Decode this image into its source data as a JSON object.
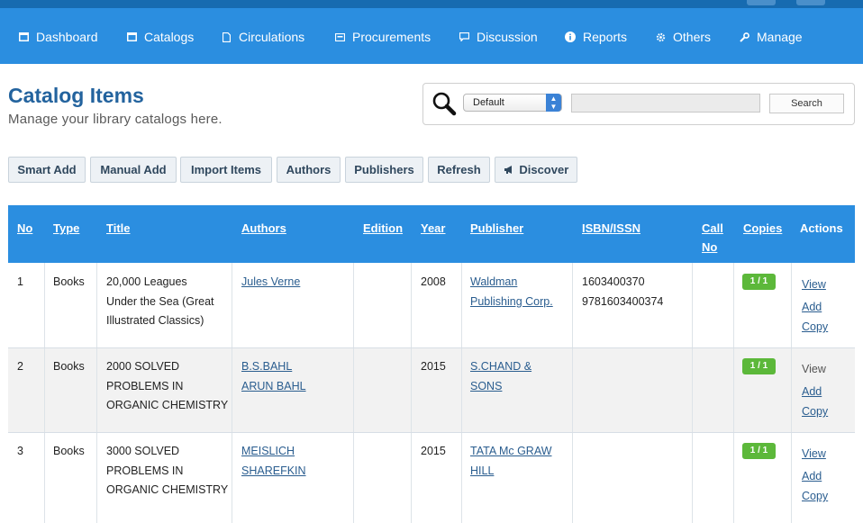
{
  "nav": {
    "items": [
      {
        "label": "Dashboard",
        "icon": "dashboard-icon"
      },
      {
        "label": "Catalogs",
        "icon": "catalogs-icon"
      },
      {
        "label": "Circulations",
        "icon": "circulations-icon"
      },
      {
        "label": "Procurements",
        "icon": "procurements-icon"
      },
      {
        "label": "Discussion",
        "icon": "discussion-icon"
      },
      {
        "label": "Reports",
        "icon": "info-icon"
      },
      {
        "label": "Others",
        "icon": "gear-icon"
      },
      {
        "label": "Manage",
        "icon": "wrench-icon"
      }
    ]
  },
  "page": {
    "title": "Catalog Items",
    "subtitle": "Manage your library catalogs here."
  },
  "search": {
    "select_value": "Default",
    "input_value": "",
    "button_label": "Search"
  },
  "toolbar": {
    "buttons": [
      {
        "label": "Smart Add"
      },
      {
        "label": "Manual Add"
      },
      {
        "label": "Import Items"
      },
      {
        "label": "Authors"
      },
      {
        "label": "Publishers"
      },
      {
        "label": "Refresh"
      },
      {
        "label": "Discover",
        "icon": "megaphone-icon"
      }
    ]
  },
  "table": {
    "headers": {
      "no": "No",
      "type": "Type",
      "title": "Title",
      "authors": "Authors",
      "edition": "Edition",
      "year": "Year",
      "publisher": "Publisher",
      "isbn": "ISBN/ISSN",
      "callno_1": "Call",
      "callno_2": "No",
      "copies": "Copies",
      "actions": "Actions"
    },
    "rows": [
      {
        "no": "1",
        "type": "Books",
        "title": [
          "20,000 Leagues",
          "Under the Sea (Great",
          "Illustrated Classics)"
        ],
        "authors": [
          "Jules Verne"
        ],
        "edition": "",
        "year": "2008",
        "publisher": [
          "Waldman",
          "Publishing Corp."
        ],
        "isbn": [
          "1603400370",
          "9781603400374"
        ],
        "callno": "",
        "copies": "1 / 1",
        "actions": {
          "view": "View",
          "add": "Add",
          "copy": "Copy"
        }
      },
      {
        "no": "2",
        "type": "Books",
        "title": [
          "2000 SOLVED",
          "PROBLEMS IN",
          "ORGANIC CHEMISTRY"
        ],
        "authors": [
          "B.S.BAHL",
          "ARUN BAHL"
        ],
        "edition": "",
        "year": "2015",
        "publisher": [
          "S.CHAND &",
          "SONS"
        ],
        "isbn": [],
        "callno": "",
        "copies": "1 / 1",
        "actions": {
          "view": "View",
          "add": "Add",
          "copy": "Copy"
        }
      },
      {
        "no": "3",
        "type": "Books",
        "title": [
          "3000 SOLVED",
          "PROBLEMS IN",
          "ORGANIC CHEMISTRY"
        ],
        "authors": [
          "MEISLICH",
          "SHAREFKIN"
        ],
        "edition": "",
        "year": "2015",
        "publisher": [
          "TATA Mc GRAW",
          "HILL"
        ],
        "isbn": [],
        "callno": "",
        "copies": "1 / 1",
        "actions": {
          "view": "View",
          "add": "Add",
          "copy": "Copy"
        }
      }
    ]
  },
  "colors": {
    "nav_bg": "#2b8ee0",
    "top_strip": "#176bb0",
    "title": "#23639e",
    "badge": "#5cb83a",
    "link": "#2a5d8f"
  }
}
